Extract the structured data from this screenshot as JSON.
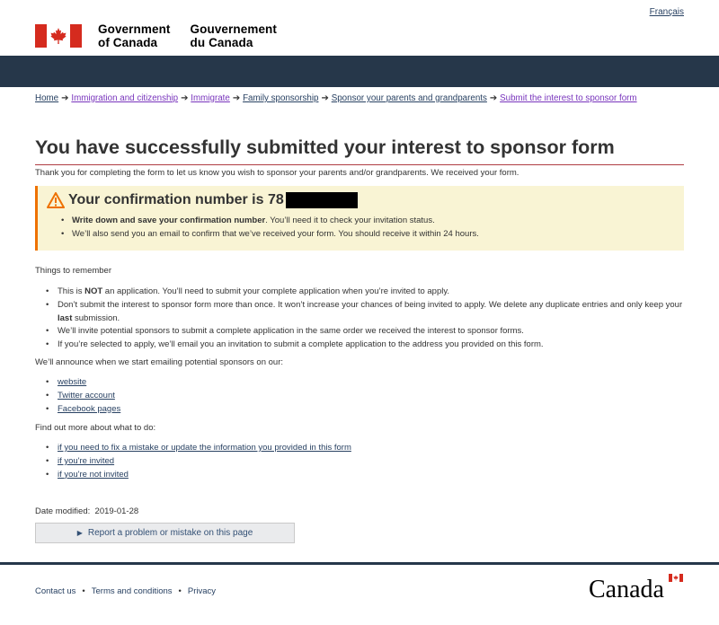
{
  "header": {
    "language_link": "Français",
    "gov_en_line1": "Government",
    "gov_en_line2": "of Canada",
    "gov_fr_line1": "Gouvernement",
    "gov_fr_line2": "du Canada"
  },
  "breadcrumb": [
    "Home",
    "Immigration and citizenship",
    "Immigrate",
    "Family sponsorship",
    "Sponsor your parents and grandparents",
    "Submit the interest to sponsor form"
  ],
  "page": {
    "title": "You have successfully submitted your interest to sponsor form",
    "intro": "Thank you for completing the form to let us know you wish to sponsor your parents and/or grandparents. We received your form."
  },
  "alert": {
    "heading": "Your confirmation number is 78",
    "item1_bold": "Write down and save your confirmation number",
    "item1_rest": ". You’ll need it to check your invitation status.",
    "item2": "We’ll also send you an email to confirm that we’ve received your form. You should receive it within 24 hours."
  },
  "remember": {
    "heading": "Things to remember",
    "item1_a": "This is ",
    "item1_b": "NOT",
    "item1_c": " an application. You’ll need to submit your complete application when you’re invited to apply.",
    "item2_a": "Don’t submit the interest to sponsor form more than once. It won’t increase your chances of being invited to apply. We delete any duplicate entries and only keep your ",
    "item2_b": "last",
    "item2_c": " submission.",
    "item3": "We’ll invite potential sponsors to submit a complete application in the same order we received the interest to sponsor forms.",
    "item4": "If you’re selected to apply, we’ll email you an invitation to submit a complete application to the address you provided on this form."
  },
  "announce": {
    "heading": "We’ll announce when we start emailing potential sponsors on our:",
    "links": [
      "website",
      "Twitter account",
      "Facebook pages"
    ]
  },
  "findout": {
    "heading": "Find out more about what to do:",
    "links": [
      "if you need to fix a mistake or update the information you provided in this form",
      "if you're invited",
      "if you're not invited"
    ]
  },
  "date_modified": {
    "label": "Date modified:",
    "value": "2019-01-28"
  },
  "report_button": "Report a problem or mistake on this page",
  "footer": {
    "links": [
      "Contact us",
      "Terms and conditions",
      "Privacy"
    ],
    "wordmark": "Canada"
  },
  "colors": {
    "header_band": "#26374a",
    "flag_red": "#d52b1e",
    "alert_bg": "#f9f4d4",
    "alert_border": "#ee7100",
    "title_rule": "#af3c43",
    "link": "#284162"
  }
}
